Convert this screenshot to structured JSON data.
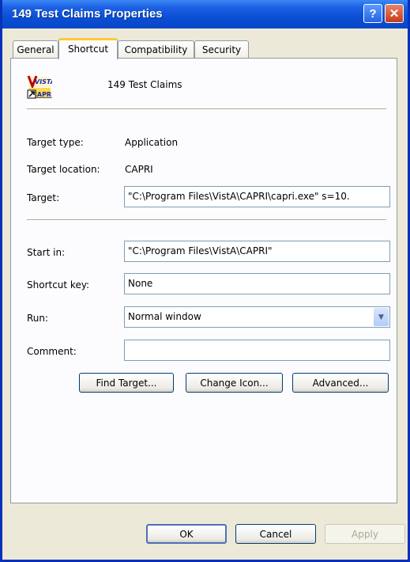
{
  "window": {
    "title": "149 Test Claims Properties",
    "help_label": "?",
    "close_label": "✕"
  },
  "tabs": [
    {
      "label": "General",
      "active": false
    },
    {
      "label": "Shortcut",
      "active": true
    },
    {
      "label": "Compatibility",
      "active": false
    },
    {
      "label": "Security",
      "active": false
    }
  ],
  "shortcut": {
    "name": "149 Test Claims",
    "icon_name": "vista-capri-app-icon",
    "icon_text_top": "VISTA",
    "icon_text_bottom": "CAPRI",
    "target_type_label": "Target type:",
    "target_type_value": "Application",
    "target_location_label": "Target location:",
    "target_location_value": "CAPRI",
    "target_label": "Target:",
    "target_value": "\"C:\\Program Files\\VistA\\CAPRI\\capri.exe\" s=10.",
    "start_in_label": "Start in:",
    "start_in_value": "\"C:\\Program Files\\VistA\\CAPRI\"",
    "shortcut_key_label": "Shortcut key:",
    "shortcut_key_value": "None",
    "run_label": "Run:",
    "run_value": "Normal window",
    "comment_label": "Comment:",
    "comment_value": "",
    "find_target_label": "Find Target...",
    "change_icon_label": "Change Icon...",
    "advanced_label": "Advanced..."
  },
  "footer": {
    "ok_label": "OK",
    "cancel_label": "Cancel",
    "apply_label": "Apply"
  },
  "colors": {
    "title_bar": "#0a4fd6",
    "dialog_bg": "#ece9d8",
    "active_tab_accent": "#ffc83c"
  }
}
